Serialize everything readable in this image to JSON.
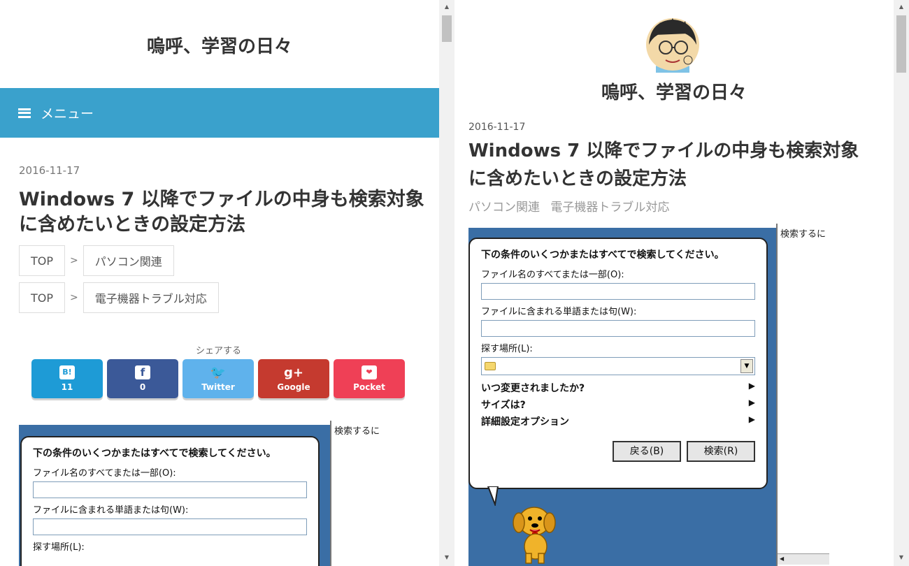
{
  "left": {
    "site_title": "嗚呼、学習の日々",
    "menu_label": "メニュー",
    "date": "2016-11-17",
    "title_line1": "Windows 7 以降でファイルの中身も検索対象",
    "title_line2": "に含めたいときの設定方法",
    "breadcrumbs": [
      {
        "top": "TOP",
        "sep": ">",
        "category": "パソコン関連"
      },
      {
        "top": "TOP",
        "sep": ">",
        "category": "電子機器トラブル対応"
      }
    ],
    "share_label": "シェアする",
    "share_buttons": [
      {
        "icon": "B!",
        "label": "11",
        "color": "#1e9bd6"
      },
      {
        "icon": "f",
        "label": "0",
        "color": "#3b5998"
      },
      {
        "icon": "🐦",
        "label": "Twitter",
        "color": "#5fb2ec"
      },
      {
        "icon": "g+",
        "label": "Google",
        "color": "#c53a2f"
      },
      {
        "icon": "❤",
        "label": "Pocket",
        "color": "#ef4056"
      }
    ]
  },
  "right": {
    "site_title": "嗚呼、学習の日々",
    "date": "2016-11-17",
    "title_line1": "Windows 7 以降でファイルの中身も検索対象",
    "title_line2": "に含めたいときの設定方法",
    "categories": [
      "パソコン関連",
      "電子機器トラブル対応"
    ]
  },
  "search_dialog": {
    "side_text": "検索するに",
    "question": "下の条件のいくつかまたはすべてで検索してください。",
    "filename_label": "ファイル名のすべてまたは一部(O):",
    "words_label": "ファイルに含まれる単語または句(W):",
    "location_label": "探す場所(L):",
    "options": [
      "いつ変更されましたか?",
      "サイズは?",
      "詳細設定オプション"
    ],
    "back_button": "戻る(B)",
    "search_button": "検索(R)"
  }
}
